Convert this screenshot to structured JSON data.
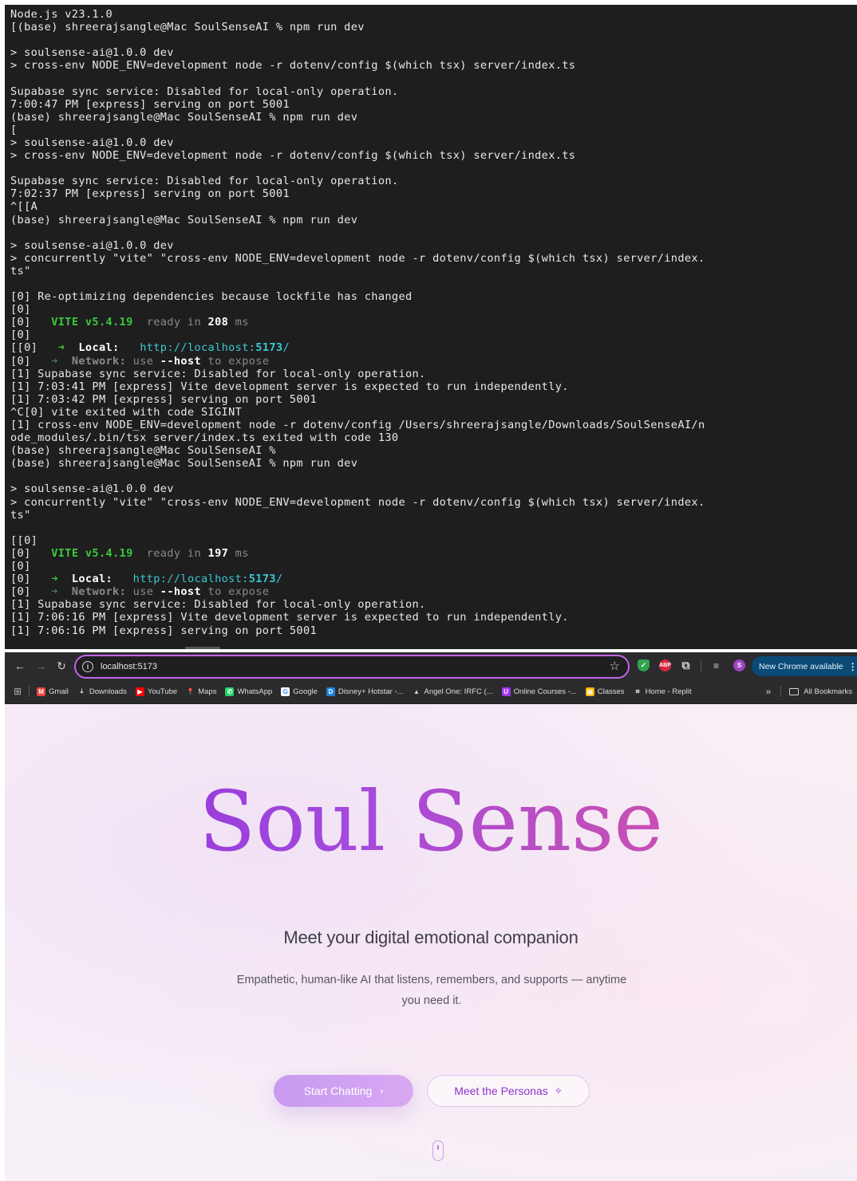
{
  "terminal": {
    "lines": [
      [
        {
          "t": "Node.js v23.1.0"
        }
      ],
      [
        {
          "t": "[(base) shreerajsangle@Mac SoulSenseAI % npm run dev"
        }
      ],
      [
        {
          "t": ""
        }
      ],
      [
        {
          "t": "> soulsense-ai@1.0.0 dev"
        }
      ],
      [
        {
          "t": "> cross-env NODE_ENV=development node -r dotenv/config $(which tsx) server/index.ts"
        }
      ],
      [
        {
          "t": ""
        }
      ],
      [
        {
          "t": "Supabase sync service: Disabled for local-only operation."
        }
      ],
      [
        {
          "t": "7:00:47 PM [express] serving on port 5001"
        }
      ],
      [
        {
          "t": "(base) shreerajsangle@Mac SoulSenseAI % npm run dev"
        }
      ],
      [
        {
          "t": "["
        }
      ],
      [
        {
          "t": "> soulsense-ai@1.0.0 dev"
        }
      ],
      [
        {
          "t": "> cross-env NODE_ENV=development node -r dotenv/config $(which tsx) server/index.ts"
        }
      ],
      [
        {
          "t": ""
        }
      ],
      [
        {
          "t": "Supabase sync service: Disabled for local-only operation."
        }
      ],
      [
        {
          "t": "7:02:37 PM [express] serving on port 5001"
        }
      ],
      [
        {
          "t": "^[[A"
        }
      ],
      [
        {
          "t": "(base) shreerajsangle@Mac SoulSenseAI % npm run dev"
        }
      ],
      [
        {
          "t": ""
        }
      ],
      [
        {
          "t": "> soulsense-ai@1.0.0 dev"
        }
      ],
      [
        {
          "t": "> concurrently \"vite\" \"cross-env NODE_ENV=development node -r dotenv/config $(which tsx) server/index."
        }
      ],
      [
        {
          "t": "ts\""
        }
      ],
      [
        {
          "t": ""
        }
      ],
      [
        {
          "t": "[0] Re-optimizing dependencies because lockfile has changed"
        }
      ],
      [
        {
          "t": "[0]"
        }
      ],
      [
        {
          "t": "[0]   "
        },
        {
          "t": "VITE v5.4.19",
          "c": "c-green"
        },
        {
          "t": "  ready in ",
          "c": "c-dim"
        },
        {
          "t": "208",
          "c": "c-bold"
        },
        {
          "t": " ms",
          "c": "c-dim"
        }
      ],
      [
        {
          "t": "[0]"
        }
      ],
      [
        {
          "t": "[[0]   "
        },
        {
          "t": "➜",
          "c": "c-arrow"
        },
        {
          "t": "  "
        },
        {
          "t": "Local:",
          "c": "c-lbl"
        },
        {
          "t": "   "
        },
        {
          "t": "http://localhost:",
          "c": "c-cyan"
        },
        {
          "t": "5173",
          "c": "c-cyanb"
        },
        {
          "t": "/",
          "c": "c-cyan"
        }
      ],
      [
        {
          "t": "[0]   "
        },
        {
          "t": "➜",
          "c": "c-arrowdim"
        },
        {
          "t": "  "
        },
        {
          "t": "Network:",
          "c": "c-lbldim"
        },
        {
          "t": " use ",
          "c": "c-dim"
        },
        {
          "t": "--host",
          "c": "c-bold"
        },
        {
          "t": " to expose",
          "c": "c-dim"
        }
      ],
      [
        {
          "t": "[1] Supabase sync service: Disabled for local-only operation."
        }
      ],
      [
        {
          "t": "[1] 7:03:41 PM [express] Vite development server is expected to run independently."
        }
      ],
      [
        {
          "t": "[1] 7:03:42 PM [express] serving on port 5001"
        }
      ],
      [
        {
          "t": "^C[0] vite exited with code SIGINT"
        }
      ],
      [
        {
          "t": "[1] cross-env NODE_ENV=development node -r dotenv/config /Users/shreerajsangle/Downloads/SoulSenseAI/n"
        }
      ],
      [
        {
          "t": "ode_modules/.bin/tsx server/index.ts exited with code 130"
        }
      ],
      [
        {
          "t": "(base) shreerajsangle@Mac SoulSenseAI %"
        }
      ],
      [
        {
          "t": "(base) shreerajsangle@Mac SoulSenseAI % npm run dev"
        }
      ],
      [
        {
          "t": ""
        }
      ],
      [
        {
          "t": "> soulsense-ai@1.0.0 dev"
        }
      ],
      [
        {
          "t": "> concurrently \"vite\" \"cross-env NODE_ENV=development node -r dotenv/config $(which tsx) server/index."
        }
      ],
      [
        {
          "t": "ts\""
        }
      ],
      [
        {
          "t": ""
        }
      ],
      [
        {
          "t": "[[0]"
        }
      ],
      [
        {
          "t": "[0]   "
        },
        {
          "t": "VITE v5.4.19",
          "c": "c-green"
        },
        {
          "t": "  ready in ",
          "c": "c-dim"
        },
        {
          "t": "197",
          "c": "c-bold"
        },
        {
          "t": " ms",
          "c": "c-dim"
        }
      ],
      [
        {
          "t": "[0]"
        }
      ],
      [
        {
          "t": "[0]   "
        },
        {
          "t": "➜",
          "c": "c-arrow"
        },
        {
          "t": "  "
        },
        {
          "t": "Local:",
          "c": "c-lbl"
        },
        {
          "t": "   "
        },
        {
          "t": "http://localhost:",
          "c": "c-cyan"
        },
        {
          "t": "5173",
          "c": "c-cyanb"
        },
        {
          "t": "/",
          "c": "c-cyan"
        }
      ],
      [
        {
          "t": "[0]   "
        },
        {
          "t": "➜",
          "c": "c-arrowdim"
        },
        {
          "t": "  "
        },
        {
          "t": "Network:",
          "c": "c-lbldim"
        },
        {
          "t": " use ",
          "c": "c-dim"
        },
        {
          "t": "--host",
          "c": "c-bold"
        },
        {
          "t": " to expose",
          "c": "c-dim"
        }
      ],
      [
        {
          "t": "[1] Supabase sync service: Disabled for local-only operation."
        }
      ],
      [
        {
          "t": "[1] 7:06:16 PM [express] Vite development server is expected to run independently."
        }
      ],
      [
        {
          "t": "[1] 7:06:16 PM [express] serving on port 5001"
        }
      ]
    ]
  },
  "browser": {
    "url": "localhost:5173",
    "new_chrome_label": "New Chrome available",
    "profile_initial": "S",
    "abp_label": "ABP",
    "bookmarks": [
      {
        "label": "Gmail",
        "icon": "gmail-icon",
        "color": "#ea4335",
        "glyph": "M"
      },
      {
        "label": "Downloads",
        "icon": "download-icon",
        "color": "transparent",
        "glyph": "⤓"
      },
      {
        "label": "YouTube",
        "icon": "youtube-icon",
        "color": "#ff0000",
        "glyph": "▶"
      },
      {
        "label": "Maps",
        "icon": "maps-pin-icon",
        "color": "transparent",
        "glyph": "📍"
      },
      {
        "label": "WhatsApp",
        "icon": "whatsapp-icon",
        "color": "#25d366",
        "glyph": "✆"
      },
      {
        "label": "Google",
        "icon": "google-icon",
        "color": "#ffffff",
        "glyph": "G"
      },
      {
        "label": "Disney+ Hotstar -...",
        "icon": "hotstar-icon",
        "color": "#1f80e0",
        "glyph": "D"
      },
      {
        "label": "Angel One: IRFC (...",
        "icon": "angel-one-icon",
        "color": "transparent",
        "glyph": "▲"
      },
      {
        "label": "Online Courses -...",
        "icon": "courses-icon",
        "color": "#a435f0",
        "glyph": "U"
      },
      {
        "label": "Classes",
        "icon": "classes-icon",
        "color": "#f4b400",
        "glyph": "▤"
      },
      {
        "label": "Home - Replit",
        "icon": "replit-icon",
        "color": "transparent",
        "glyph": "⧈"
      }
    ],
    "all_bookmarks_label": "All Bookmarks"
  },
  "hero": {
    "title": "Soul Sense",
    "subtitle": "Meet your digital emotional companion",
    "description": "Empathetic, human-like AI that listens, remembers, and supports — anytime you need it.",
    "start_button": "Start Chatting",
    "personas_button": "Meet the Personas"
  },
  "colors": {
    "terminal_bg": "#1e1e1e",
    "accent_purple": "#8f2ed8",
    "accent_pink": "#e04aa5",
    "omnibox_border": "#c465e3"
  }
}
